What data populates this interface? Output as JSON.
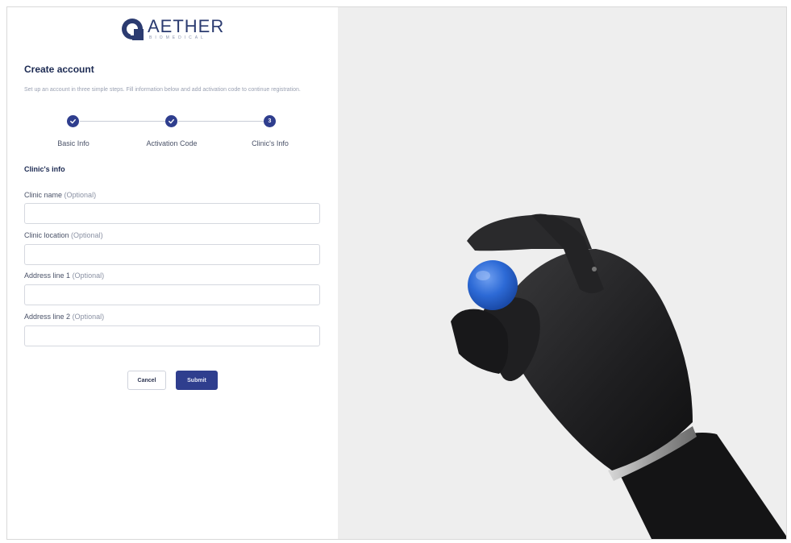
{
  "brand": {
    "name": "AETHER",
    "subtitle": "BIOMEDICAL",
    "color": "#2b3b70"
  },
  "form": {
    "title": "Create account",
    "description": "Set up an account in three simple steps. Fill information below and add activation code to continue registration.",
    "steps": [
      {
        "label": "Basic Info",
        "state": "complete",
        "icon": "check-icon"
      },
      {
        "label": "Activation Code",
        "state": "complete",
        "icon": "check-icon"
      },
      {
        "label": "Clinic's Info",
        "state": "current",
        "number": "3"
      }
    ],
    "section_title": "Clinic's info",
    "fields": [
      {
        "label": "Clinic name",
        "optional": "(Optional)",
        "value": ""
      },
      {
        "label": "Clinic location",
        "optional": "(Optional)",
        "value": ""
      },
      {
        "label": "Address line 1",
        "optional": "(Optional)",
        "value": ""
      },
      {
        "label": "Address line 2",
        "optional": "(Optional)",
        "value": ""
      }
    ],
    "cancel_label": "Cancel",
    "submit_label": "Submit"
  },
  "colors": {
    "accent": "#2f3e8e",
    "hero_background": "#eeeeee"
  }
}
